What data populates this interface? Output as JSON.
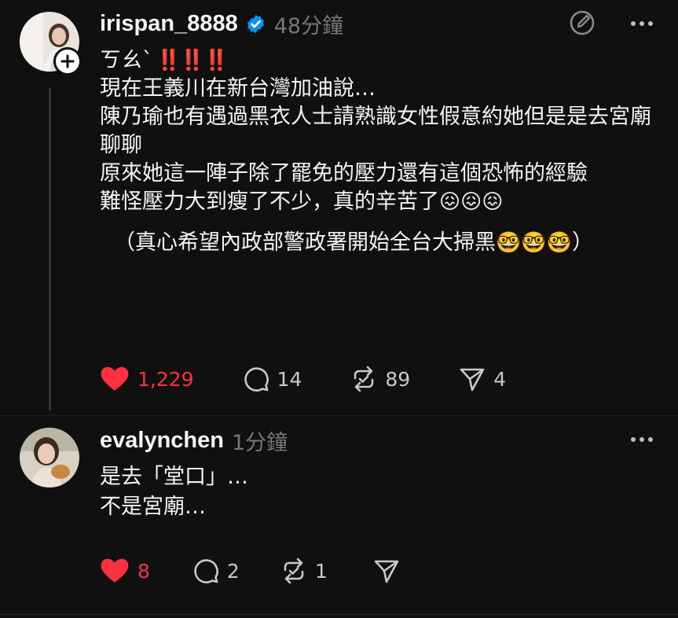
{
  "main_post": {
    "username": "irispan_8888",
    "verified": true,
    "timestamp": "48分鐘",
    "text_lines": [
      "ㄎㄠˋ",
      "‼️‼️‼️",
      "現在王義川在新台灣加油說…",
      "陳乃瑜也有遇過黑衣人士請熟識女性假意約她但是是去宮廟聊聊",
      "原來她這一陣子除了罷免的壓力還有這個恐怖的經驗",
      "難怪壓力大到瘦了不少，真的辛苦了",
      "😖😖😖",
      "（真心希望內政部警政署開始全台大掃黑",
      "🤓🤓🤓",
      "）"
    ],
    "actions": {
      "likes": "1,229",
      "comments": "14",
      "reposts": "89",
      "shares": "4"
    },
    "liked": true,
    "icons": [
      "follow-plus-icon",
      "verified-badge-icon",
      "new-note-icon",
      "more-icon",
      "heart-icon",
      "comment-icon",
      "repost-icon",
      "share-icon"
    ]
  },
  "reply_post": {
    "username": "evalynchen",
    "timestamp": "1分鐘",
    "text_lines": [
      "是去「堂口」…",
      "不是宮廟…"
    ],
    "actions": {
      "likes": "8",
      "comments": "2",
      "reposts": "1"
    },
    "liked": true
  },
  "colors": {
    "background": "#101010",
    "text": "#f3f5f7",
    "muted": "#777777",
    "like_red": "#ff3040",
    "verified_blue": "#0095f6"
  }
}
